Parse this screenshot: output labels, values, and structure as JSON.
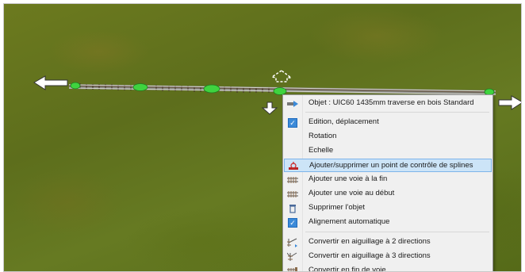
{
  "menu": {
    "header": "Objet : UIC60 1435mm traverse en bois Standard",
    "items": [
      {
        "label": "Edition, déplacement",
        "checked": true
      },
      {
        "label": "Rotation"
      },
      {
        "label": "Echelle"
      },
      {
        "label": "Ajouter/supprimer un point de contrôle de splines",
        "highlighted": true
      },
      {
        "label": "Ajouter une voie à la fin"
      },
      {
        "label": "Ajouter une voie au début"
      },
      {
        "label": "Supprimer l'objet"
      },
      {
        "label": "Alignement automatique",
        "checked": true
      },
      {
        "label": "Convertir en aiguillage à 2 directions"
      },
      {
        "label": "Convertir en aiguillage à 3 directions"
      },
      {
        "label": "Convertir en fin de voie"
      }
    ]
  },
  "colors": {
    "highlight_bg": "#cce4f7",
    "check_blue": "#3c8ad8",
    "control_point": "#3fd33f"
  },
  "icons": {
    "header": "object-track-icon",
    "spline": "spline-point-icon",
    "add_track": "track-segment-icon",
    "delete": "trash-icon",
    "switch2": "switch-2way-icon",
    "switch3": "switch-3way-icon",
    "end": "track-end-icon"
  }
}
